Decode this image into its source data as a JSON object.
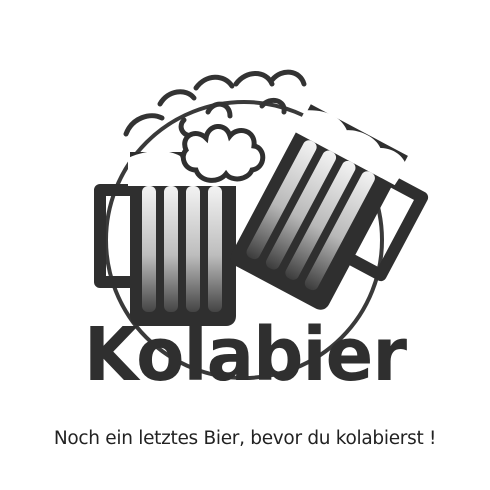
{
  "brand": {
    "name": "Kolabier",
    "tagline": "Noch ein letztes Bier, bevor du kolabierst !"
  },
  "colors": {
    "outline": "#2f2f2f",
    "glass_light": "#f2f2f2",
    "glass_dark": "#3a3a3a",
    "background": "#ffffff"
  },
  "icons": {
    "logo": "two-beer-mugs-toasting-icon"
  }
}
